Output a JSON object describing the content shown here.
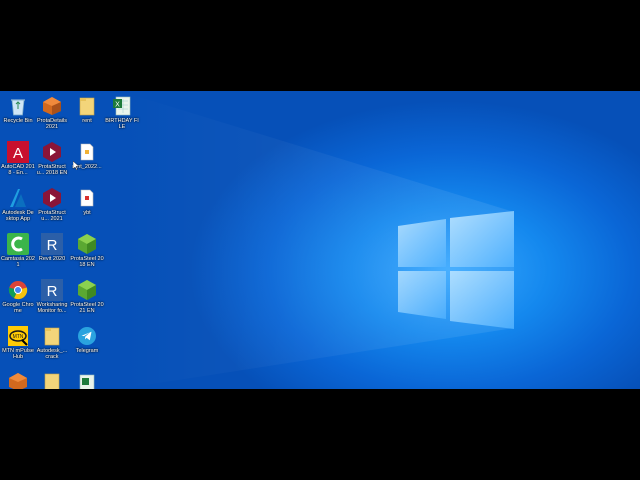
{
  "desktop": {
    "icons": [
      {
        "label": "Recycle Bin",
        "icon": "recycle-bin-icon"
      },
      {
        "label": "ProtaDetails 2021",
        "icon": "prota-details-icon"
      },
      {
        "label": "rent",
        "icon": "folder-icon"
      },
      {
        "label": "BIRTHDAY FILE",
        "icon": "excel-file-icon"
      },
      {
        "label": "AutoCAD 2018 - En...",
        "icon": "autocad-icon"
      },
      {
        "label": "ProtaStructu... 2018 EN",
        "icon": "prota-structure-icon"
      },
      {
        "label": "rent_2022...",
        "icon": "document-icon"
      },
      {
        "label": "Autodesk Desktop App",
        "icon": "autodesk-app-icon"
      },
      {
        "label": "ProtaStructu... 2021",
        "icon": "prota-structure-icon"
      },
      {
        "label": "ybt",
        "icon": "pdf-file-icon"
      },
      {
        "label": "Camtasia 2021",
        "icon": "camtasia-icon"
      },
      {
        "label": "Revit 2020",
        "icon": "revit-icon"
      },
      {
        "label": "ProtaSteel 2018 EN",
        "icon": "prota-steel-icon"
      },
      {
        "label": "Google Chrome",
        "icon": "chrome-icon"
      },
      {
        "label": "Worksharing Monitor fo...",
        "icon": "revit-icon"
      },
      {
        "label": "ProtaSteel 2021 EN",
        "icon": "prota-steel-icon"
      },
      {
        "label": "MTN mPulse Hub",
        "icon": "mtn-icon"
      },
      {
        "label": "Autodesk_... crack",
        "icon": "folder-icon"
      },
      {
        "label": "Telegram",
        "icon": "telegram-icon"
      }
    ]
  },
  "colors": {
    "wallpaper": "#0a66d6",
    "wallpaper_glow": "#3aa9ff",
    "autocad": "#c8102e",
    "prota": "#8a1538",
    "revit": "#2b5fa8",
    "camtasia": "#3bb54a"
  }
}
